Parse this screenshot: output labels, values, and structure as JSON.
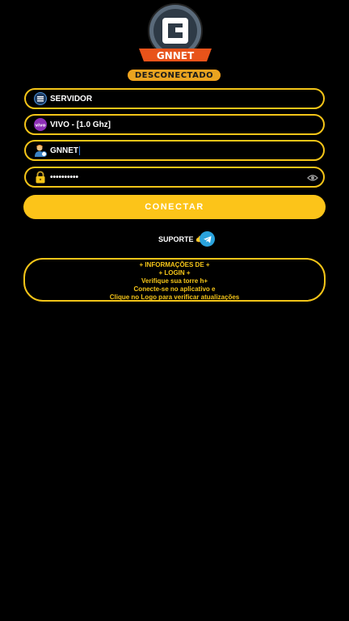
{
  "app": {
    "logo_text": "GNNET",
    "status": "DESCONECTADO"
  },
  "form": {
    "server": "SERVIDOR",
    "network": "VIVO - [1.0 Ghz]",
    "network_badge": "vivo",
    "username": "GNNET",
    "password_masked": "••••••••••"
  },
  "actions": {
    "connect_label": "CONECTAR",
    "support_label": "SUPORTE 👉"
  },
  "info": {
    "lines": [
      "+ INFORMAÇÕES DE +",
      "+ LOGIN +",
      "Verifique sua torre h+",
      "Conecte-se no aplicativo e",
      "Clique no Logo para verificar atualizações"
    ]
  },
  "colors": {
    "accent": "#f5c518",
    "button": "#fcc419",
    "telegram": "#2aa3dd",
    "background": "#000000"
  }
}
